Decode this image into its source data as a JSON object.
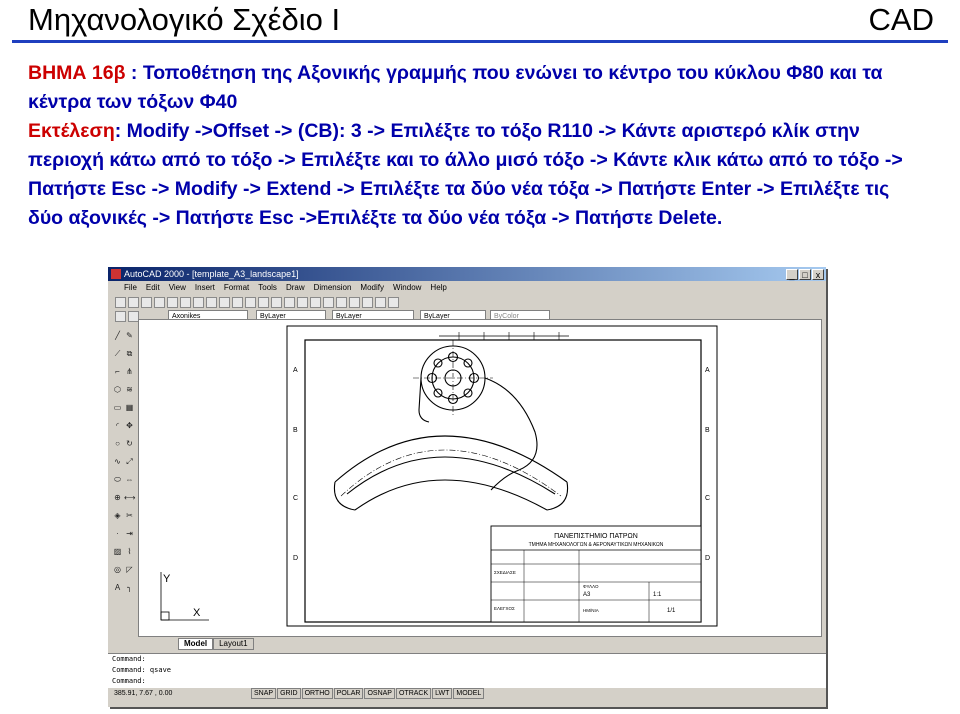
{
  "slide": {
    "title": "Μηχανολογικό Σχέδιο Ι",
    "corner": "CAD"
  },
  "instructions": {
    "step_label": "ΒΗΜΑ 16β",
    "step_text": "Τοποθέτηση της Αξονικής γραμμής  που ενώνει το κέντρο του κύκλου Φ80 και τα κέντρα των τόξων Φ40",
    "exec_label": "Εκτέλεση",
    "exec_text": "Modify ->Offset -> (CB): 3 -> Επιλέξτε το τόξο R110 -> Κάντε αριστερό κλίκ στην περιοχή κάτω από το τόξο -> Επιλέξτε και το άλλο μισό τόξο -> Κάντε κλικ κάτω από το τόξο -> Πατήστε Esc -> Modify -> Extend -> Επιλέξτε τα δύο νέα τόξα -> Πατήστε Enter -> Επιλέξτε τις δύο αξονικές -> Πατήστε Esc ->Επιλέξτε τα δύο νέα τόξα -> Πατήστε Delete."
  },
  "window": {
    "title": "AutoCAD 2000 - [template_A3_landscape1]",
    "min": "_",
    "max": "□",
    "close": "x"
  },
  "menu": [
    "File",
    "Edit",
    "View",
    "Insert",
    "Format",
    "Tools",
    "Draw",
    "Dimension",
    "Modify",
    "Window",
    "Help"
  ],
  "properties": {
    "layer": "Axonikes",
    "color": "ByLayer",
    "linetype": "ByLayer",
    "lineweight": "ByLayer",
    "plotstyle": "ByColor"
  },
  "drawing": {
    "border_letters_left": [
      "A",
      "B",
      "C",
      "D"
    ],
    "border_letters_right": [
      "A",
      "B",
      "C",
      "D"
    ],
    "titleblock": {
      "line1": "ΠΑΝΕΠΙΣΤΗΜΙΟ  ΠΑΤΡΩΝ",
      "line2": "ΤΜΗΜΑ ΜΗΧΑΝΟΛΟΓΩΝ & ΑΕΡΟΝΑΥΤΙΚΩΝ ΜΗΧΑΝΙΚΩΝ",
      "drawn": "ΣΧΕΔΙΑΣΕ",
      "checked": "ΕΛΕΓΧΟΣ",
      "date": "ΗΜ/ΝΙΑ",
      "sheet_label": "ΦΥΛΛΟ",
      "sheet_size": "A3",
      "scale": "1:1",
      "sheet_no": "1/1"
    },
    "ucs_y": "Y",
    "ucs_x": "X"
  },
  "tabs": [
    "Model",
    "Layout1"
  ],
  "command": {
    "line1": "Command:",
    "line2": "Command: qsave",
    "line3": "Command:"
  },
  "status": {
    "coords": "385.91, 7.67 , 0.00",
    "toggles": [
      "SNAP",
      "GRID",
      "ORTHO",
      "POLAR",
      "OSNAP",
      "OTRACK",
      "LWT",
      "MODEL"
    ]
  }
}
